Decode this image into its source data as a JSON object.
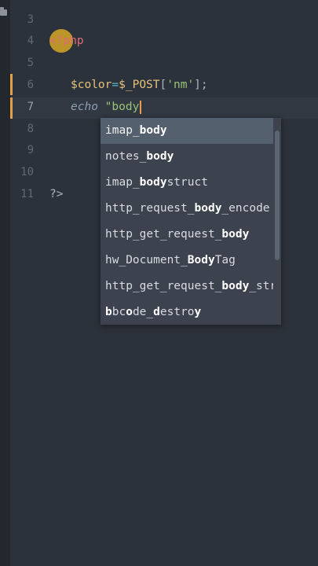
{
  "gutter": {
    "line_numbers": [
      "3",
      "4",
      "5",
      "6",
      "7",
      "8",
      "9",
      "10",
      "11"
    ],
    "active_line": "7"
  },
  "code": {
    "line4": {
      "php_open": "<?php"
    },
    "line6": {
      "var": "$color",
      "op": "=",
      "superglobal": "$_POST",
      "bracket_open": "[",
      "key": "'nm'",
      "bracket_close": "]",
      "semicolon": ";"
    },
    "line7": {
      "keyword": "echo",
      "string": "\"body"
    },
    "line11": {
      "php_close": "?>"
    }
  },
  "autocomplete": {
    "items": [
      {
        "parts": [
          {
            "t": "imap_",
            "m": false
          },
          {
            "t": "body",
            "m": true
          }
        ],
        "selected": true
      },
      {
        "parts": [
          {
            "t": "notes_",
            "m": false
          },
          {
            "t": "body",
            "m": true
          }
        ],
        "selected": false
      },
      {
        "parts": [
          {
            "t": "imap_",
            "m": false
          },
          {
            "t": "body",
            "m": true
          },
          {
            "t": "struct",
            "m": false
          }
        ],
        "selected": false
      },
      {
        "parts": [
          {
            "t": "http_request_",
            "m": false
          },
          {
            "t": "body",
            "m": true
          },
          {
            "t": "_encode",
            "m": false
          }
        ],
        "selected": false
      },
      {
        "parts": [
          {
            "t": "http_get_request_",
            "m": false
          },
          {
            "t": "body",
            "m": true
          }
        ],
        "selected": false
      },
      {
        "parts": [
          {
            "t": "hw_Document_",
            "m": false
          },
          {
            "t": "Body",
            "m": true
          },
          {
            "t": "Tag",
            "m": false
          }
        ],
        "selected": false
      },
      {
        "parts": [
          {
            "t": "http_get_request_",
            "m": false
          },
          {
            "t": "body",
            "m": true
          },
          {
            "t": "_stream",
            "m": false
          }
        ],
        "selected": false
      },
      {
        "parts": [
          {
            "t": "b",
            "m": true
          },
          {
            "t": "bc",
            "m": false
          },
          {
            "t": "o",
            "m": true
          },
          {
            "t": "de_",
            "m": false
          },
          {
            "t": "d",
            "m": true
          },
          {
            "t": "estro",
            "m": false
          },
          {
            "t": "y",
            "m": true
          }
        ],
        "selected": false
      }
    ]
  },
  "colors": {
    "background": "#2c323b",
    "modified_marker": "#e5a14a",
    "cursor_highlight": "#d6a726",
    "popup": "#3c434e",
    "popup_selected": "#55606e"
  }
}
